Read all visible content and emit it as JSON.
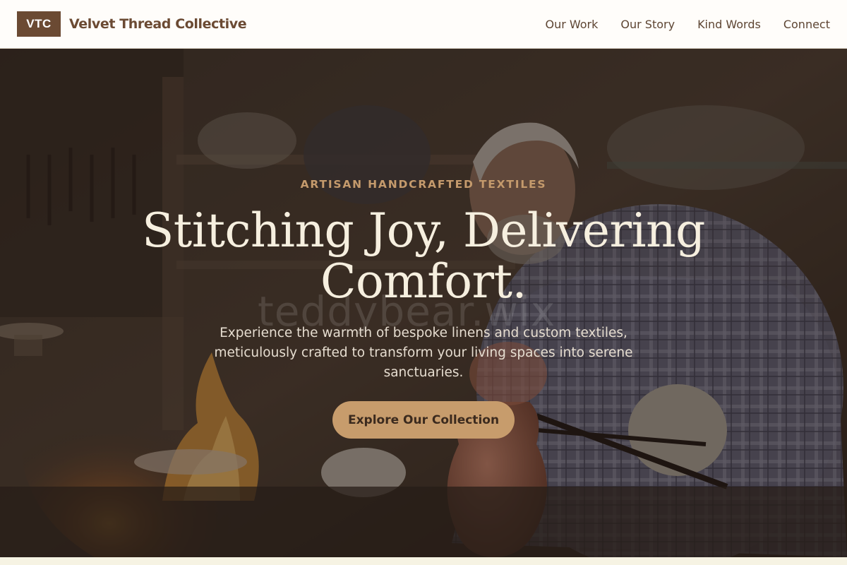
{
  "header": {
    "logo_text": "VTC",
    "brand_name": "Velvet Thread Collective",
    "nav": [
      {
        "label": "Our Work"
      },
      {
        "label": "Our Story"
      },
      {
        "label": "Kind Words"
      },
      {
        "label": "Connect"
      }
    ]
  },
  "hero": {
    "eyebrow": "ARTISAN HANDCRAFTED TEXTILES",
    "headline": "Stitching Joy, Delivering Comfort.",
    "watermark": "teddybear.wix",
    "subtext": "Experience the warmth of bespoke linens and custom textiles, meticulously crafted to transform your living spaces into serene sanctuaries.",
    "cta_label": "Explore Our Collection",
    "image_icon": "workshop-artisan-photo"
  },
  "colors": {
    "brand": "#6b4a33",
    "accent": "#c79c6c",
    "headline": "#f6efdf",
    "eyebrow": "#c49a6c"
  }
}
